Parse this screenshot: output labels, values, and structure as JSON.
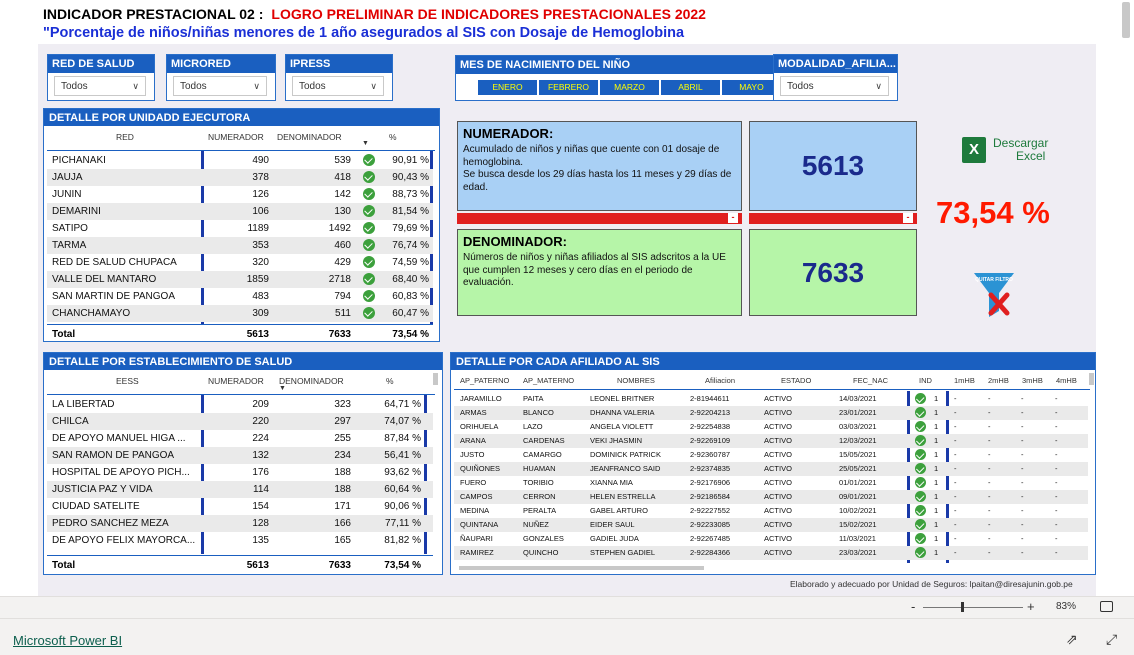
{
  "header": {
    "title_prefix": "INDICADOR PRESTACIONAL 02 :",
    "title_red": "LOGRO PRELIMINAR DE INDICADORES PRESTACIONALES 2022",
    "subtitle": "\"Porcentaje de niños/niñas menores de 1 año asegurados al SIS con Dosaje de Hemoglobina"
  },
  "slicers": [
    {
      "label": "RED DE SALUD",
      "value": "Todos"
    },
    {
      "label": "MICRORED",
      "value": "Todos"
    },
    {
      "label": "IPRESS",
      "value": "Todos"
    },
    {
      "label": "MODALIDAD_AFILIA...",
      "value": "Todos"
    }
  ],
  "months": {
    "label": "MES DE NACIMIENTO DEL NIÑO",
    "items": [
      "ENERO",
      "FEBRERO",
      "MARZO",
      "ABRIL",
      "MAYO"
    ]
  },
  "table_ue": {
    "title": "DETALLE POR UNIDADD EJECUTORA",
    "columns": [
      "RED",
      "NUMERADOR",
      "DENOMINADOR",
      "%"
    ],
    "rows": [
      [
        "PICHANAKI",
        "490",
        "539",
        "90,91 %"
      ],
      [
        "JAUJA",
        "378",
        "418",
        "90,43 %"
      ],
      [
        "JUNIN",
        "126",
        "142",
        "88,73 %"
      ],
      [
        "DEMARINI",
        "106",
        "130",
        "81,54 %"
      ],
      [
        "SATIPO",
        "1189",
        "1492",
        "79,69 %"
      ],
      [
        "TARMA",
        "353",
        "460",
        "76,74 %"
      ],
      [
        "RED DE SALUD CHUPACA",
        "320",
        "429",
        "74,59 %"
      ],
      [
        "VALLE DEL MANTARO",
        "1859",
        "2718",
        "68,40 %"
      ],
      [
        "SAN MARTIN DE PANGOA",
        "483",
        "794",
        "60,83 %"
      ],
      [
        "CHANCHAMAYO",
        "309",
        "511",
        "60,47 %"
      ]
    ],
    "total": [
      "Total",
      "5613",
      "7633",
      "73,54 %"
    ]
  },
  "numerador": {
    "title": "NUMERADOR:",
    "text": "Acumulado de niños y niñas que cuente con 01 dosaje de hemoglobina.\nSe busca desde los 29 días hasta los 11 meses y 29 días de edad.",
    "value": "5613"
  },
  "denominador": {
    "title": "DENOMINADOR:",
    "text": "Números de niños y niñas afiliados al SIS adscritos a la UE que cumplen 12 meses y cero días en el periodo de evaluación.",
    "value": "7633"
  },
  "percentage": "73,54 %",
  "excel": {
    "line1": "Descargar",
    "line2": "Excel",
    "icon": "excel-icon"
  },
  "filter_icon": {
    "label": "QUITAR FILTRO",
    "icon": "clear-filter-icon"
  },
  "table_eess": {
    "title": "DETALLE POR ESTABLECIMIENTO DE SALUD",
    "columns": [
      "EESS",
      "NUMERADOR",
      "DENOMINADOR",
      "%"
    ],
    "rows": [
      [
        "LA LIBERTAD",
        "209",
        "323",
        "64,71 %"
      ],
      [
        "CHILCA",
        "220",
        "297",
        "74,07 %"
      ],
      [
        "DE APOYO MANUEL HIGA ...",
        "224",
        "255",
        "87,84 %"
      ],
      [
        "SAN RAMON DE PANGOA",
        "132",
        "234",
        "56,41 %"
      ],
      [
        "HOSPITAL DE APOYO PICH...",
        "176",
        "188",
        "93,62 %"
      ],
      [
        "JUSTICIA PAZ Y VIDA",
        "114",
        "188",
        "60,64 %"
      ],
      [
        "CIUDAD SATELITE",
        "154",
        "171",
        "90,06 %"
      ],
      [
        "PEDRO SANCHEZ MEZA",
        "128",
        "166",
        "77,11 %"
      ],
      [
        "DE APOYO FELIX MAYORCA...",
        "135",
        "165",
        "81,82 %"
      ]
    ],
    "total": [
      "Total",
      "5613",
      "7633",
      "73,54 %"
    ]
  },
  "table_afiliado": {
    "title": "DETALLE POR CADA AFILIADO AL SIS",
    "columns": [
      "AP_PATERNO",
      "AP_MATERNO",
      "NOMBRES",
      "Afiliacion",
      "ESTADO",
      "FEC_NAC",
      "IND",
      "1mHB",
      "2mHB",
      "3mHB",
      "4mHB"
    ],
    "rows": [
      [
        "JARAMILLO",
        "PAITA",
        "LEONEL BRITNER",
        "2-81944611",
        "ACTIVO",
        "14/03/2021",
        "1",
        "-",
        "-",
        "-",
        "-"
      ],
      [
        "ARMAS",
        "BLANCO",
        "DHANNA VALERIA",
        "2-92204213",
        "ACTIVO",
        "23/01/2021",
        "1",
        "-",
        "-",
        "-",
        "-"
      ],
      [
        "ORIHUELA",
        "LAZO",
        "ANGELA VIOLETT",
        "2-92254838",
        "ACTIVO",
        "03/03/2021",
        "1",
        "-",
        "-",
        "-",
        "-"
      ],
      [
        "ARANA",
        "CARDENAS",
        "VEKI JHASMIN",
        "2-92269109",
        "ACTIVO",
        "12/03/2021",
        "1",
        "-",
        "-",
        "-",
        "-"
      ],
      [
        "JUSTO",
        "CAMARGO",
        "DOMINICK PATRICK",
        "2-92360787",
        "ACTIVO",
        "15/05/2021",
        "1",
        "-",
        "-",
        "-",
        "-"
      ],
      [
        "QUIÑONES",
        "HUAMAN",
        "JEANFRANCO SAID",
        "2-92374835",
        "ACTIVO",
        "25/05/2021",
        "1",
        "-",
        "-",
        "-",
        "-"
      ],
      [
        "FUERO",
        "TORIBIO",
        "XIANNA MIA",
        "2-92176906",
        "ACTIVO",
        "01/01/2021",
        "1",
        "-",
        "-",
        "-",
        "-"
      ],
      [
        "CAMPOS",
        "CERRON",
        "HELEN ESTRELLA",
        "2-92186584",
        "ACTIVO",
        "09/01/2021",
        "1",
        "-",
        "-",
        "-",
        "-"
      ],
      [
        "MEDINA",
        "PERALTA",
        "GABEL ARTURO",
        "2-92227552",
        "ACTIVO",
        "10/02/2021",
        "1",
        "-",
        "-",
        "-",
        "-"
      ],
      [
        "QUINTANA",
        "NUÑEZ",
        "EIDER SAUL",
        "2-92233085",
        "ACTIVO",
        "15/02/2021",
        "1",
        "-",
        "-",
        "-",
        "-"
      ],
      [
        "ÑAUPARI",
        "GONZALES",
        "GADIEL JUDA",
        "2-92267485",
        "ACTIVO",
        "11/03/2021",
        "1",
        "-",
        "-",
        "-",
        "-"
      ],
      [
        "RAMIREZ",
        "QUINCHO",
        "STEPHEN GADIEL",
        "2-92284366",
        "ACTIVO",
        "23/03/2021",
        "1",
        "-",
        "-",
        "-",
        "-"
      ]
    ]
  },
  "footnote": "Elaborado y adecuado por  Unidad de Seguros: lpaitan@diresajunin.gob.pe",
  "zoom": {
    "minus": "-",
    "plus": "+",
    "value": "83%"
  },
  "app": {
    "name": "Microsoft Power BI",
    "share_icon": "share-icon",
    "expand_icon": "expand-icon"
  },
  "colors": {
    "accent": "#1a5fc0",
    "red": "#e01f1f",
    "numerador_bg": "#a9d0f5",
    "denominador_bg": "#b6f5a8"
  }
}
